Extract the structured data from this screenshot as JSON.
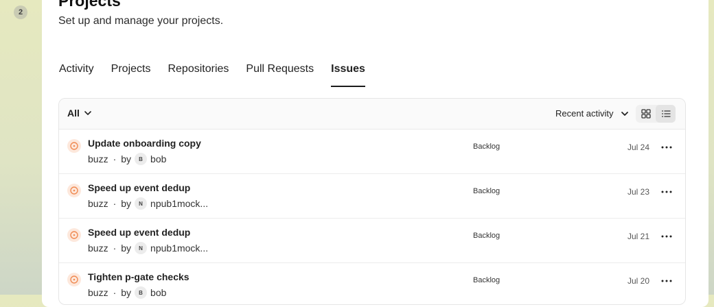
{
  "rail": {
    "badge": "2"
  },
  "page": {
    "title": "Projects",
    "subtitle": "Set up and manage your projects."
  },
  "tabs": [
    {
      "label": "Activity",
      "active": false
    },
    {
      "label": "Projects",
      "active": false
    },
    {
      "label": "Repositories",
      "active": false
    },
    {
      "label": "Pull Requests",
      "active": false
    },
    {
      "label": "Issues",
      "active": true
    }
  ],
  "toolbar": {
    "filter": "All",
    "sort": "Recent activity",
    "view_modes": [
      "grid-icon",
      "list-icon"
    ],
    "active_view": "list-icon"
  },
  "issues": [
    {
      "title": "Update onboarding copy",
      "repo": "buzz",
      "by": "by",
      "avatar": "B",
      "author": "bob",
      "status": "Backlog",
      "date": "Jul 24"
    },
    {
      "title": "Speed up event dedup",
      "repo": "buzz",
      "by": "by",
      "avatar": "N",
      "author": "npub1mock...",
      "status": "Backlog",
      "date": "Jul 23"
    },
    {
      "title": "Speed up event dedup",
      "repo": "buzz",
      "by": "by",
      "avatar": "N",
      "author": "npub1mock...",
      "status": "Backlog",
      "date": "Jul 21"
    },
    {
      "title": "Tighten p-gate checks",
      "repo": "buzz",
      "by": "by",
      "avatar": "B",
      "author": "bob",
      "status": "Backlog",
      "date": "Jul 20"
    }
  ],
  "colors": {
    "status_open": "#f08a52",
    "status_open_bg": "#fde8dc",
    "accent_text": "#1a1a1a"
  }
}
